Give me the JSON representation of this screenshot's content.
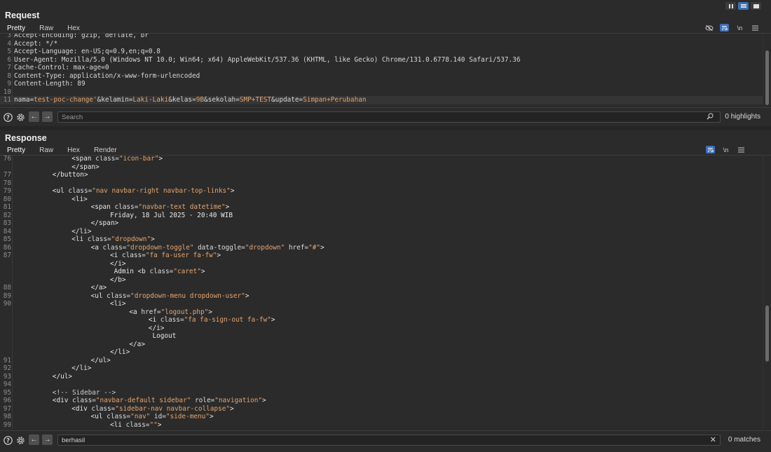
{
  "request": {
    "title": "Request",
    "tabs": [
      "Pretty",
      "Raw",
      "Hex"
    ],
    "active_tab": "Pretty",
    "icons": [
      "eye-slash-icon",
      "wrap-icon",
      "newline-icon",
      "menu-icon"
    ],
    "newline_label": "\\n",
    "lines": [
      {
        "n": "3",
        "text": "Accept-Encoding: gzip, deflate, br"
      },
      {
        "n": "4",
        "text": "Accept: */*"
      },
      {
        "n": "5",
        "text": "Accept-Language: en-US;q=0.9,en;q=0.8"
      },
      {
        "n": "6",
        "text": "User-Agent: Mozilla/5.0 (Windows NT 10.0; Win64; x64) AppleWebKit/537.36 (KHTML, like Gecko) Chrome/131.0.6778.140 Safari/537.36"
      },
      {
        "n": "7",
        "text": "Cache-Control: max-age=0"
      },
      {
        "n": "8",
        "text": "Content-Type: application/x-www-form-urlencoded"
      },
      {
        "n": "9",
        "text": "Content-Length: 89"
      },
      {
        "n": "10",
        "text": ""
      }
    ],
    "body_line": {
      "n": "11",
      "params": [
        {
          "k": "nama",
          "v": "test-poc-change'"
        },
        {
          "k": "kelamin",
          "v": "Laki-Laki"
        },
        {
          "k": "kelas",
          "v": "9B"
        },
        {
          "k": "sekolah",
          "v": "SMP+TEST"
        },
        {
          "k": "update",
          "v": "Simpan+Perubahan"
        }
      ]
    },
    "search": {
      "placeholder": "Search",
      "value": "",
      "count": "0 highlights"
    }
  },
  "response": {
    "title": "Response",
    "tabs": [
      "Pretty",
      "Raw",
      "Hex",
      "Render"
    ],
    "active_tab": "Pretty",
    "newline_label": "\\n",
    "lines": [
      {
        "n": "76",
        "indent": 6,
        "parts": [
          [
            "t",
            "<span "
          ],
          [
            "a",
            "class="
          ],
          [
            "s",
            "\"icon-bar\""
          ],
          [
            "t",
            ">"
          ]
        ]
      },
      {
        "n": "",
        "indent": 6,
        "parts": [
          [
            "t",
            "</span>"
          ]
        ]
      },
      {
        "n": "77",
        "indent": 4,
        "parts": [
          [
            "t",
            "</button>"
          ]
        ]
      },
      {
        "n": "78",
        "indent": 0,
        "parts": []
      },
      {
        "n": "79",
        "indent": 4,
        "parts": [
          [
            "t",
            "<ul "
          ],
          [
            "a",
            "class="
          ],
          [
            "s",
            "\"nav navbar-right navbar-top-links\""
          ],
          [
            "t",
            ">"
          ]
        ]
      },
      {
        "n": "80",
        "indent": 6,
        "parts": [
          [
            "t",
            "<li>"
          ]
        ]
      },
      {
        "n": "81",
        "indent": 8,
        "parts": [
          [
            "t",
            "<span "
          ],
          [
            "a",
            "class="
          ],
          [
            "s",
            "\"navbar-text datetime\""
          ],
          [
            "t",
            ">"
          ]
        ]
      },
      {
        "n": "82",
        "indent": 10,
        "parts": [
          [
            "t",
            "Friday, 18 Jul 2025 - 20:40 WIB"
          ]
        ]
      },
      {
        "n": "83",
        "indent": 8,
        "parts": [
          [
            "t",
            "</span>"
          ]
        ]
      },
      {
        "n": "84",
        "indent": 6,
        "parts": [
          [
            "t",
            "</li>"
          ]
        ]
      },
      {
        "n": "85",
        "indent": 6,
        "parts": [
          [
            "t",
            "<li "
          ],
          [
            "a",
            "class="
          ],
          [
            "s",
            "\"dropdown\""
          ],
          [
            "t",
            ">"
          ]
        ]
      },
      {
        "n": "86",
        "indent": 8,
        "parts": [
          [
            "t",
            "<a "
          ],
          [
            "a",
            "class="
          ],
          [
            "s",
            "\"dropdown-toggle\""
          ],
          [
            "a",
            " data-toggle="
          ],
          [
            "s",
            "\"dropdown\""
          ],
          [
            "a",
            " href="
          ],
          [
            "s",
            "\"#\""
          ],
          [
            "t",
            ">"
          ]
        ]
      },
      {
        "n": "87",
        "indent": 10,
        "parts": [
          [
            "t",
            "<i "
          ],
          [
            "a",
            "class="
          ],
          [
            "s",
            "\"fa fa-user fa-fw\""
          ],
          [
            "t",
            ">"
          ]
        ]
      },
      {
        "n": "",
        "indent": 10,
        "parts": [
          [
            "t",
            "</i>"
          ]
        ]
      },
      {
        "n": "",
        "indent": 10,
        "parts": [
          [
            "t",
            " Admin <b "
          ],
          [
            "a",
            "class="
          ],
          [
            "s",
            "\"caret\""
          ],
          [
            "t",
            ">"
          ]
        ]
      },
      {
        "n": "",
        "indent": 10,
        "parts": [
          [
            "t",
            "</b>"
          ]
        ]
      },
      {
        "n": "88",
        "indent": 8,
        "parts": [
          [
            "t",
            "</a>"
          ]
        ]
      },
      {
        "n": "89",
        "indent": 8,
        "parts": [
          [
            "t",
            "<ul "
          ],
          [
            "a",
            "class="
          ],
          [
            "s",
            "\"dropdown-menu dropdown-user\""
          ],
          [
            "t",
            ">"
          ]
        ]
      },
      {
        "n": "90",
        "indent": 10,
        "parts": [
          [
            "t",
            "<li>"
          ]
        ]
      },
      {
        "n": "",
        "indent": 12,
        "parts": [
          [
            "t",
            "<a "
          ],
          [
            "a",
            "href="
          ],
          [
            "s",
            "\"logout.php\""
          ],
          [
            "t",
            ">"
          ]
        ]
      },
      {
        "n": "",
        "indent": 14,
        "parts": [
          [
            "t",
            "<i "
          ],
          [
            "a",
            "class="
          ],
          [
            "s",
            "\"fa fa-sign-out fa-fw\""
          ],
          [
            "t",
            ">"
          ]
        ]
      },
      {
        "n": "",
        "indent": 14,
        "parts": [
          [
            "t",
            "</i>"
          ]
        ]
      },
      {
        "n": "",
        "indent": 14,
        "parts": [
          [
            "t",
            " Logout"
          ]
        ]
      },
      {
        "n": "",
        "indent": 12,
        "parts": [
          [
            "t",
            "</a>"
          ]
        ]
      },
      {
        "n": "",
        "indent": 10,
        "parts": [
          [
            "t",
            "</li>"
          ]
        ]
      },
      {
        "n": "91",
        "indent": 8,
        "parts": [
          [
            "t",
            "</ul>"
          ]
        ]
      },
      {
        "n": "92",
        "indent": 6,
        "parts": [
          [
            "t",
            "</li>"
          ]
        ]
      },
      {
        "n": "93",
        "indent": 4,
        "parts": [
          [
            "t",
            "</ul>"
          ]
        ]
      },
      {
        "n": "94",
        "indent": 0,
        "parts": []
      },
      {
        "n": "95",
        "indent": 4,
        "parts": [
          [
            "c",
            "<!-- Sidebar -->"
          ]
        ]
      },
      {
        "n": "96",
        "indent": 4,
        "parts": [
          [
            "t",
            "<div "
          ],
          [
            "a",
            "class="
          ],
          [
            "s",
            "\"navbar-default sidebar\""
          ],
          [
            "a",
            " role="
          ],
          [
            "s",
            "\"navigation\""
          ],
          [
            "t",
            ">"
          ]
        ]
      },
      {
        "n": "97",
        "indent": 6,
        "parts": [
          [
            "t",
            "<div "
          ],
          [
            "a",
            "class="
          ],
          [
            "s",
            "\"sidebar-nav navbar-collapse\""
          ],
          [
            "t",
            ">"
          ]
        ]
      },
      {
        "n": "98",
        "indent": 8,
        "parts": [
          [
            "t",
            "<ul "
          ],
          [
            "a",
            "class="
          ],
          [
            "s",
            "\"nav\""
          ],
          [
            "a",
            " id="
          ],
          [
            "s",
            "\"side-menu\""
          ],
          [
            "t",
            ">"
          ]
        ]
      },
      {
        "n": "99",
        "indent": 10,
        "parts": [
          [
            "t",
            "<li "
          ],
          [
            "a",
            "class="
          ],
          [
            "s",
            "\"\""
          ],
          [
            "t",
            ">"
          ]
        ]
      }
    ],
    "search": {
      "placeholder": "",
      "value": "berhasil",
      "count": "0 matches"
    }
  }
}
